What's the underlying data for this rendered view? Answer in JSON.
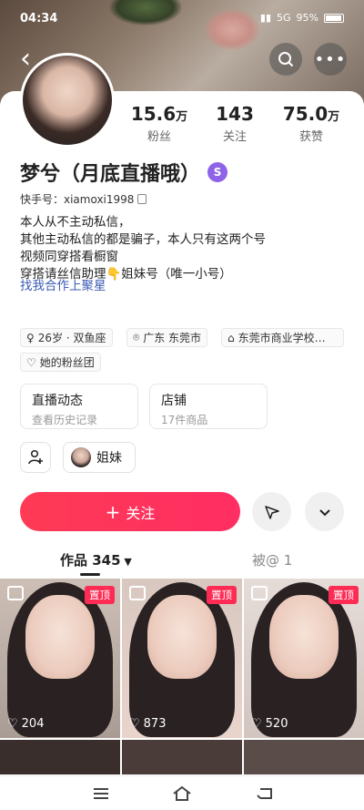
{
  "status_bar": {
    "time": "04:34",
    "signal_text": "5G",
    "battery": "95%"
  },
  "profile": {
    "name": "梦兮（月底直播哦）",
    "kuaishou_id": "快手号：xiamoxi1998",
    "stats": [
      {
        "num": "15.6",
        "unit": "万",
        "label": "粉丝"
      },
      {
        "num": "143",
        "unit": "",
        "label": "关注"
      },
      {
        "num": "75.0",
        "unit": "万",
        "label": "获赞"
      }
    ],
    "bio_lines": [
      "本人从不主动私信，",
      "其他主动私信的都是骗子，本人只有这两个号",
      "视频同穿搭看橱窗",
      "穿搭请丝信助理👇姐妹号（唯一小号）"
    ],
    "link_text": "找我合作上聚星",
    "tags": [
      "26岁 · 双鱼座",
      "广东 东莞市",
      "东莞市商业学校…",
      "她的粉丝团"
    ]
  },
  "cards": [
    {
      "title": "直播动态",
      "sub": "查看历史记录"
    },
    {
      "title": "店铺",
      "sub": "17件商品"
    }
  ],
  "friend_label": "姐妹",
  "follow_label": "关注",
  "tabs": {
    "works": "作品 345",
    "mentioned": "被@ 1"
  },
  "posts": [
    {
      "pinned": "置顶",
      "likes": "204"
    },
    {
      "pinned": "置顶",
      "likes": "873"
    },
    {
      "pinned": "置顶",
      "likes": "520"
    }
  ]
}
